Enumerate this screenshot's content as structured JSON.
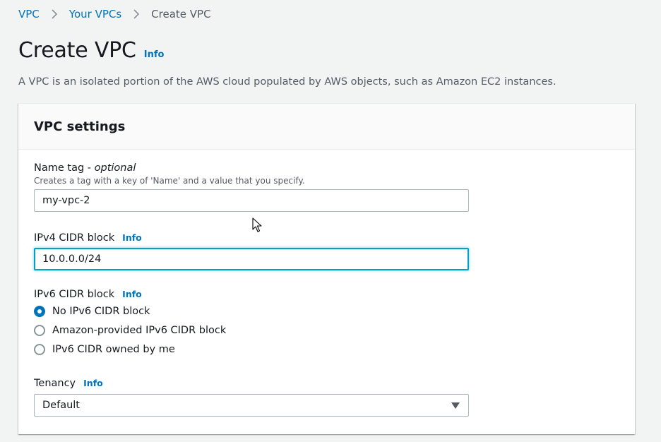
{
  "breadcrumb": {
    "items": [
      "VPC",
      "Your VPCs",
      "Create VPC"
    ]
  },
  "page": {
    "title": "Create VPC",
    "info": "Info",
    "description": "A VPC is an isolated portion of the AWS cloud populated by AWS objects, such as Amazon EC2 instances."
  },
  "panel": {
    "title": "VPC settings"
  },
  "name_tag": {
    "label": "Name tag - ",
    "optional": "optional",
    "hint": "Creates a tag with a key of 'Name' and a value that you specify.",
    "value": "my-vpc-2"
  },
  "ipv4": {
    "label": "IPv4 CIDR block",
    "info": "Info",
    "value": "10.0.0.0/24"
  },
  "ipv6": {
    "label": "IPv6 CIDR block",
    "info": "Info",
    "options": [
      "No IPv6 CIDR block",
      "Amazon-provided IPv6 CIDR block",
      "IPv6 CIDR owned by me"
    ],
    "selected": "No IPv6 CIDR block"
  },
  "tenancy": {
    "label": "Tenancy",
    "info": "Info",
    "value": "Default"
  },
  "colors": {
    "link": "#0073bb",
    "focus": "#00a1c9",
    "background": "#f2f3f3"
  },
  "icons": {
    "breadcrumb_separator": "chevron-right-icon",
    "select_arrow": "caret-down-icon",
    "pointer": "mouse-cursor-icon"
  }
}
